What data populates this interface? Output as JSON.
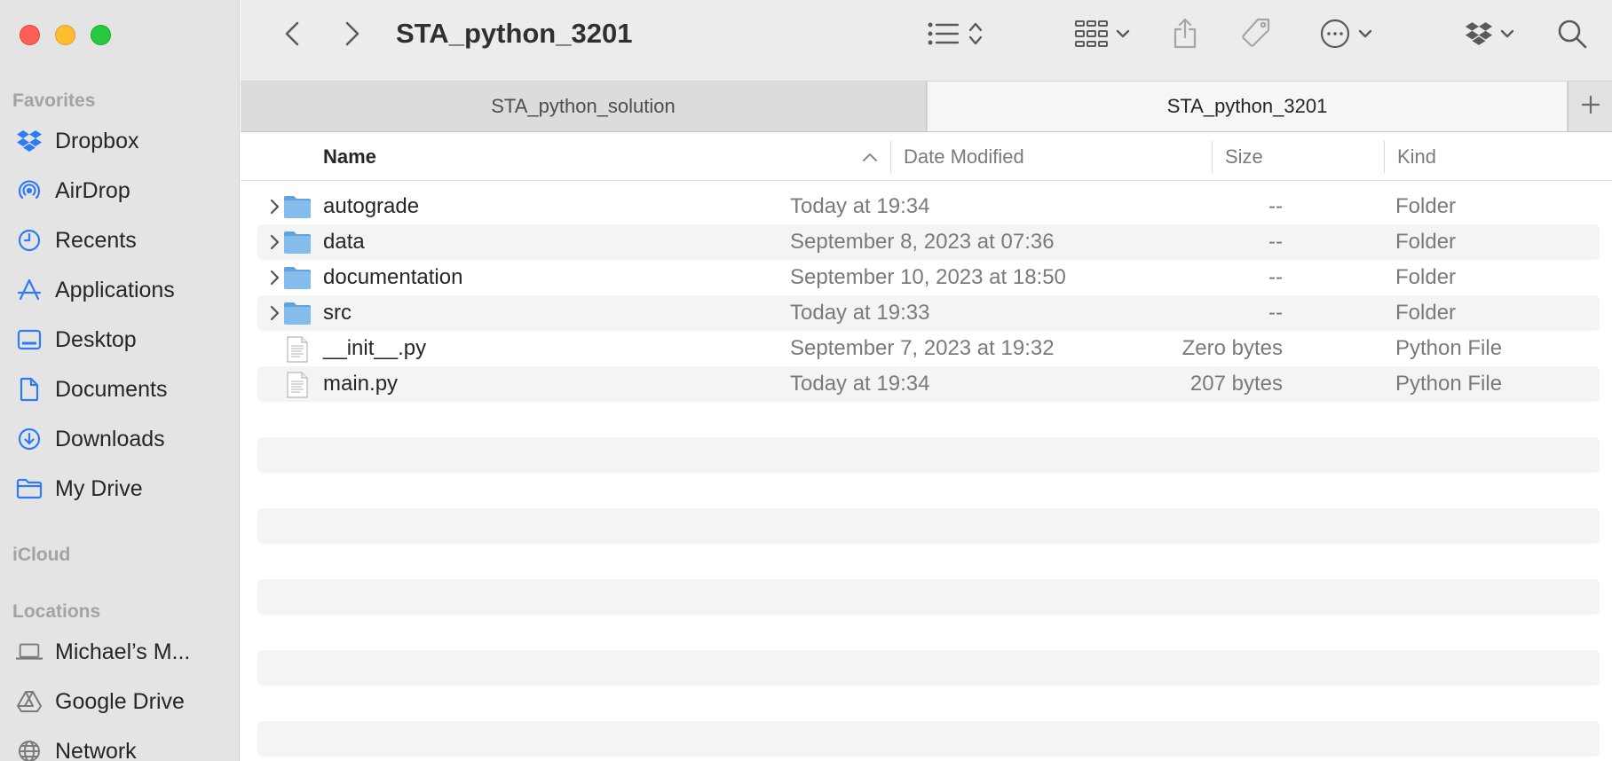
{
  "window": {
    "title": "STA_python_3201"
  },
  "sidebar": {
    "favorites_label": "Favorites",
    "icloud_label": "iCloud",
    "locations_label": "Locations",
    "favorites": [
      {
        "label": "Dropbox",
        "icon": "dropbox-icon"
      },
      {
        "label": "AirDrop",
        "icon": "airdrop-icon"
      },
      {
        "label": "Recents",
        "icon": "clock-icon"
      },
      {
        "label": "Applications",
        "icon": "applications-icon"
      },
      {
        "label": "Desktop",
        "icon": "desktop-icon"
      },
      {
        "label": "Documents",
        "icon": "document-icon"
      },
      {
        "label": "Downloads",
        "icon": "download-icon"
      },
      {
        "label": "My Drive",
        "icon": "folder-icon"
      }
    ],
    "locations": [
      {
        "label": "Michael’s M...",
        "icon": "laptop-icon"
      },
      {
        "label": "Google Drive",
        "icon": "google-drive-icon"
      },
      {
        "label": "Network",
        "icon": "globe-icon"
      }
    ]
  },
  "tabs": [
    {
      "label": "STA_python_solution",
      "active": false
    },
    {
      "label": "STA_python_3201",
      "active": true
    }
  ],
  "columns": {
    "name": "Name",
    "date": "Date Modified",
    "size": "Size",
    "kind": "Kind"
  },
  "files": [
    {
      "name": "autograde",
      "date": "Today at 19:34",
      "size": "--",
      "kind": "Folder",
      "type": "folder"
    },
    {
      "name": "data",
      "date": "September 8, 2023 at 07:36",
      "size": "--",
      "kind": "Folder",
      "type": "folder"
    },
    {
      "name": "documentation",
      "date": "September 10, 2023 at 18:50",
      "size": "--",
      "kind": "Folder",
      "type": "folder"
    },
    {
      "name": "src",
      "date": "Today at 19:33",
      "size": "--",
      "kind": "Folder",
      "type": "folder"
    },
    {
      "name": "__init__.py",
      "date": "September 7, 2023 at 19:32",
      "size": "Zero bytes",
      "kind": "Python File",
      "type": "file"
    },
    {
      "name": "main.py",
      "date": "Today at 19:34",
      "size": "207 bytes",
      "kind": "Python File",
      "type": "file"
    }
  ],
  "colors": {
    "accent": "#2f7bf5",
    "folder": "#7ab8ea",
    "sidebar_bg": "#e4e4e4"
  }
}
